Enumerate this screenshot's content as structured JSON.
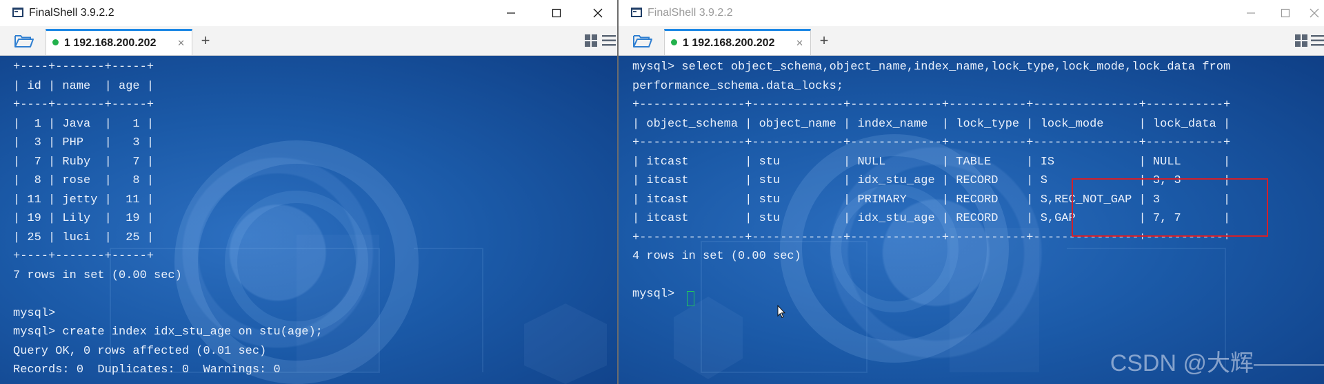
{
  "left_window": {
    "title": "FinalShell 3.9.2.2",
    "tab": {
      "index": "1",
      "host": "192.168.200.202",
      "label": "1 192.168.200.202"
    },
    "terminal_lines": [
      "+----+-------+-----+",
      "| id | name  | age |",
      "+----+-------+-----+",
      "|  1 | Java  |   1 |",
      "|  3 | PHP   |   3 |",
      "|  7 | Ruby  |   7 |",
      "|  8 | rose  |   8 |",
      "| 11 | jetty |  11 |",
      "| 19 | Lily  |  19 |",
      "| 25 | luci  |  25 |",
      "+----+-------+-----+",
      "7 rows in set (0.00 sec)",
      "",
      "mysql>",
      "mysql> create index idx_stu_age on stu(age);",
      "Query OK, 0 rows affected (0.01 sec)",
      "Records: 0  Duplicates: 0  Warnings: 0"
    ]
  },
  "right_window": {
    "title": "FinalShell 3.9.2.2",
    "tab": {
      "index": "1",
      "host": "192.168.200.202",
      "label": "1 192.168.200.202"
    },
    "terminal_lines": [
      "mysql> select object_schema,object_name,index_name,lock_type,lock_mode,lock_data from",
      "performance_schema.data_locks;",
      "+---------------+-------------+-------------+-----------+---------------+-----------+",
      "| object_schema | object_name | index_name  | lock_type | lock_mode     | lock_data |",
      "+---------------+-------------+-------------+-----------+---------------+-----------+",
      "| itcast        | stu         | NULL        | TABLE     | IS            | NULL      |",
      "| itcast        | stu         | idx_stu_age | RECORD    | S             | 3, 3      |",
      "| itcast        | stu         | PRIMARY     | RECORD    | S,REC_NOT_GAP | 3         |",
      "| itcast        | stu         | idx_stu_age | RECORD    | S,GAP         | 7, 7      |",
      "+---------------+-------------+-------------+-----------+---------------+-----------+",
      "4 rows in set (0.00 sec)",
      "",
      "mysql> "
    ],
    "watermark": "CSDN @大辉———"
  },
  "colors": {
    "tab_accent": "#1e88e5",
    "connected_dot": "#22b14c",
    "terminal_text": "#e9f0fb",
    "highlight_box": "#d3202a",
    "cursor": "#22c55e"
  },
  "icons": {
    "app": "finalshell-app-icon",
    "folder": "folder-open-icon",
    "minimize": "minimize-icon",
    "maximize": "maximize-icon",
    "close": "close-icon",
    "tab_close": "close-icon",
    "new_tab": "plus-icon",
    "layout": "grid-layout-icon",
    "menu": "hamburger-menu-icon",
    "pointer": "mouse-pointer-icon"
  }
}
